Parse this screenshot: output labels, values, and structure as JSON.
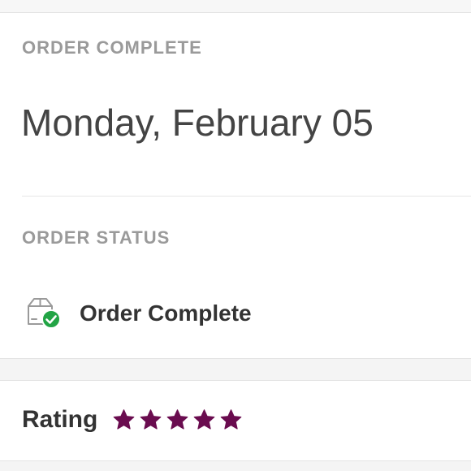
{
  "order": {
    "complete_label": "ORDER COMPLETE",
    "date": "Monday, February 05",
    "status_label": "ORDER STATUS",
    "status_text": "Order Complete",
    "status_icon": "box-check-icon"
  },
  "rating": {
    "label": "Rating",
    "stars": 5,
    "max": 5,
    "star_color": "#6a0c4f"
  },
  "colors": {
    "check_green": "#22a445",
    "label_gray": "#9a9a9a",
    "text_dark": "#333333"
  }
}
